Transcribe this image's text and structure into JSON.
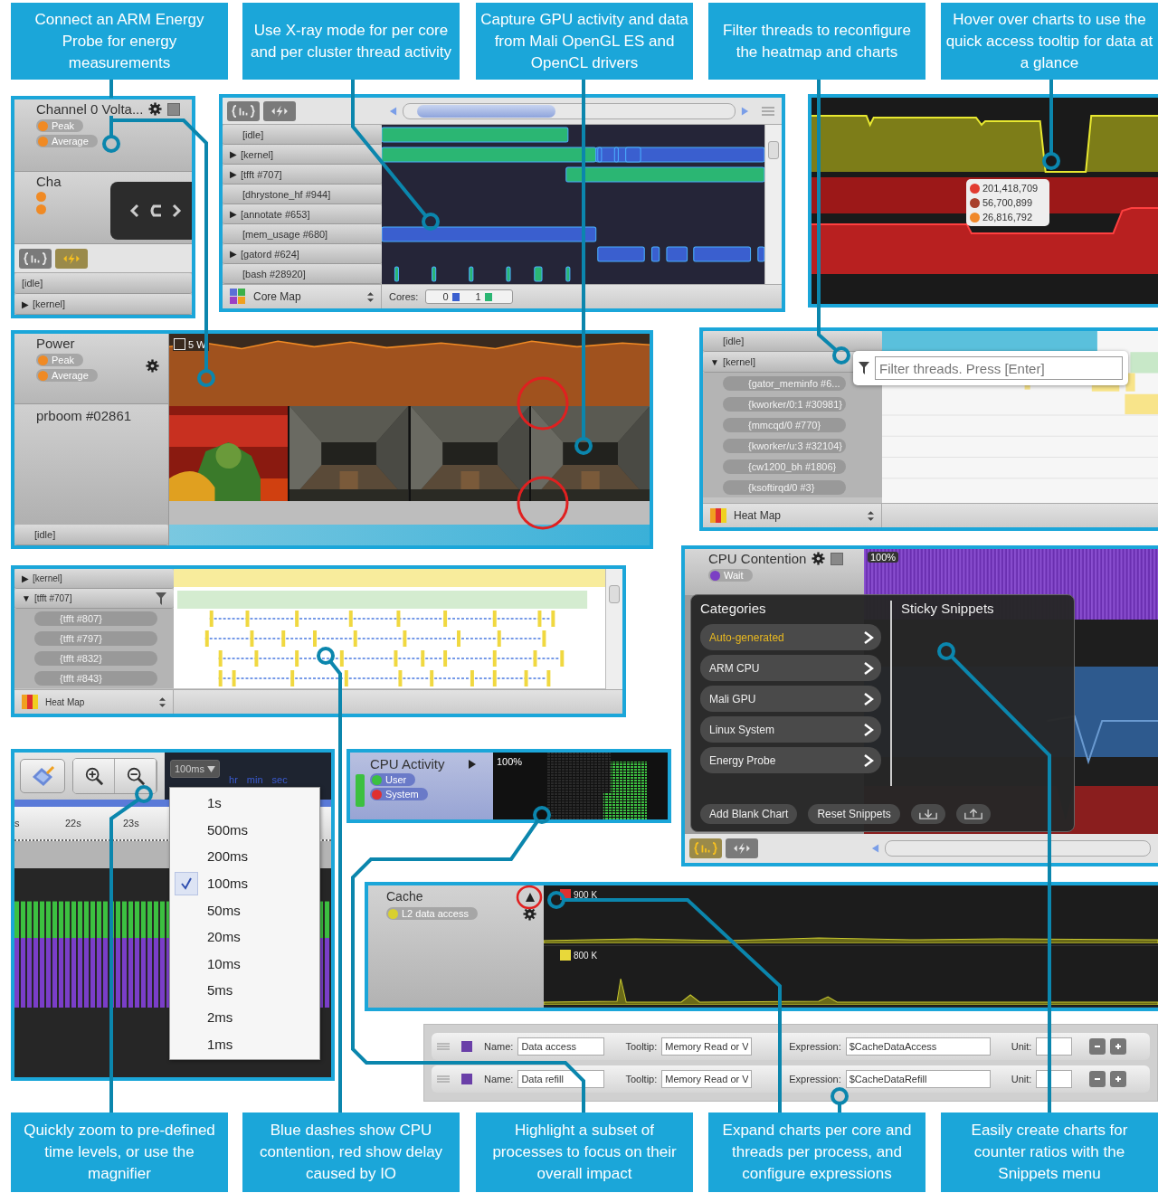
{
  "captions_top": [
    {
      "text": "Connect an ARM Energy Probe for energy measurements"
    },
    {
      "text": "Use X-ray mode for per core and per cluster thread activity"
    },
    {
      "text": "Capture GPU activity and data from Mali OpenGL ES and OpenCL drivers"
    },
    {
      "text": "Filter threads to reconfigure the heatmap and charts"
    },
    {
      "text": "Hover over charts to use the quick access tooltip for data at a glance"
    }
  ],
  "captions_bottom": [
    {
      "text": "Quickly zoom to pre-defined time levels, or use the magnifier"
    },
    {
      "text": "Blue dashes show CPU contention, red show delay caused by IO"
    },
    {
      "text": "Highlight a subset of processes to focus on their overall impact"
    },
    {
      "text": "Expand charts per core and threads per process, and configure expressions"
    },
    {
      "text": "Easily create charts for counter ratios with the Snippets menu"
    }
  ],
  "energy_panel": {
    "channels": [
      {
        "name": "Channel 0 Volta...",
        "legend": [
          "Peak",
          "Average"
        ]
      },
      {
        "name": "Cha"
      }
    ],
    "modes": [
      {
        "kind": "charts",
        "selected": false
      },
      {
        "kind": "xray",
        "selected": true
      }
    ],
    "rows": [
      {
        "label": "[idle]"
      },
      {
        "toggle": "▶",
        "label": "[kernel]"
      }
    ]
  },
  "xray_panel": {
    "modes": [
      {
        "kind": "charts",
        "selected": false
      },
      {
        "kind": "xray",
        "selected": false
      }
    ],
    "rows": [
      {
        "label": "[idle]"
      },
      {
        "toggle": "▶",
        "label": "[kernel]"
      },
      {
        "toggle": "▶",
        "label": "[tfft #707]"
      },
      {
        "label": "[dhrystone_hf #944]"
      },
      {
        "toggle": "▶",
        "label": "[annotate #653]"
      },
      {
        "label": "[mem_usage #680]"
      },
      {
        "toggle": "▶",
        "label": "[gatord #624]"
      },
      {
        "label": "[bash #28920]"
      }
    ],
    "map": "Core Map",
    "cores_label": "Cores:",
    "cores": [
      {
        "label": "0",
        "color": "#3a5fcf"
      },
      {
        "label": "1",
        "color": "#2bb673"
      }
    ]
  },
  "tooltip_panel": {
    "values": [
      {
        "text": "201,418,709",
        "color": "#e23b30"
      },
      {
        "text": "56,700,899",
        "color": "#a8402c"
      },
      {
        "text": "26,816,792",
        "color": "#f0882a"
      }
    ]
  },
  "power_panel": {
    "title": "Power",
    "legend": [
      "Peak",
      "Average"
    ],
    "scale": "5 W",
    "process": "prboom #02861",
    "frames": [
      {
        "kind": "picture"
      },
      {
        "kind": "picture"
      },
      {
        "kind": "picture"
      },
      {
        "kind": "picture"
      }
    ],
    "idle": "[idle]"
  },
  "filter_panel": {
    "rows": [
      {
        "label": "[idle]"
      },
      {
        "toggle": "▼",
        "label": "[kernel]",
        "children": [
          "{gator_meminfo #6...",
          "{kworker/0:1 #30981}",
          "{mmcqd/0 #770}",
          "{kworker/u:3 #32104}",
          "{cw1200_bh #1806}",
          "{ksoftirqd/0 #3}"
        ]
      }
    ],
    "filter": {
      "placeholder": "Filter threads. Press [Enter]"
    },
    "map": "Heat Map"
  },
  "heat_panel": {
    "rows": [
      {
        "toggle": "▶",
        "label": "[kernel]"
      },
      {
        "toggle": "▼",
        "label": "[tfft #707]",
        "children": [
          "{tfft #807}",
          "{tfft #797}",
          "{tfft #832}",
          "{tfft #843}"
        ]
      }
    ],
    "map": "Heat Map"
  },
  "contention_panel": {
    "title": "CPU Contention",
    "legend": [
      {
        "name": "Wait",
        "color": "#7b3fc4"
      }
    ],
    "scale": "100%",
    "menu": {
      "categories_title": "Categories",
      "categories": [
        {
          "label": "Auto-generated",
          "selected": true
        },
        {
          "label": "ARM CPU",
          "selected": false
        },
        {
          "label": "Mali GPU",
          "selected": false
        },
        {
          "label": "Linux System",
          "selected": false
        },
        {
          "label": "Energy Probe",
          "selected": false
        }
      ],
      "snippets_title": "Sticky Snippets",
      "buttons": [
        "Add Blank Chart",
        "Reset Snippets"
      ]
    },
    "modes": [
      {
        "kind": "charts",
        "selected": true
      },
      {
        "kind": "xray",
        "selected": false
      }
    ]
  },
  "zoom_panel": {
    "interval": "100ms",
    "clock_units": [
      "hr",
      "min",
      "sec"
    ],
    "ruler": [
      "s",
      "22s",
      "23s"
    ],
    "intervals": [
      {
        "label": "1s",
        "selected": false
      },
      {
        "label": "500ms",
        "selected": false
      },
      {
        "label": "200ms",
        "selected": false
      },
      {
        "label": "100ms",
        "selected": true
      },
      {
        "label": "50ms",
        "selected": false
      },
      {
        "label": "20ms",
        "selected": false
      },
      {
        "label": "10ms",
        "selected": false
      },
      {
        "label": "5ms",
        "selected": false
      },
      {
        "label": "2ms",
        "selected": false
      },
      {
        "label": "1ms",
        "selected": false
      }
    ]
  },
  "activity_panel": {
    "title": "CPU Activity",
    "legend": [
      {
        "name": "User",
        "color": "#3cc040"
      },
      {
        "name": "System",
        "color": "#e03030"
      }
    ],
    "scale": "100%"
  },
  "cache_panel": {
    "title": "Cache",
    "legend": [
      {
        "name": "L2 data access",
        "color": "#d8d030"
      }
    ],
    "scales": [
      {
        "label": "900 K",
        "color": "#e03030"
      },
      {
        "label": "800 K",
        "color": "#e8d83a"
      }
    ]
  },
  "expressions": [
    {
      "name_label": "Name:",
      "name": "Data access",
      "tooltip_label": "Tooltip:",
      "tooltip": "Memory Read or V",
      "expression_label": "Expression:",
      "expression": "$CacheDataAccess",
      "unit_label": "Unit:"
    },
    {
      "name_label": "Name:",
      "name": "Data refill",
      "tooltip_label": "Tooltip:",
      "tooltip": "Memory Read or V",
      "expression_label": "Expression:",
      "expression": "$CacheDataRefill",
      "unit_label": "Unit:"
    }
  ]
}
